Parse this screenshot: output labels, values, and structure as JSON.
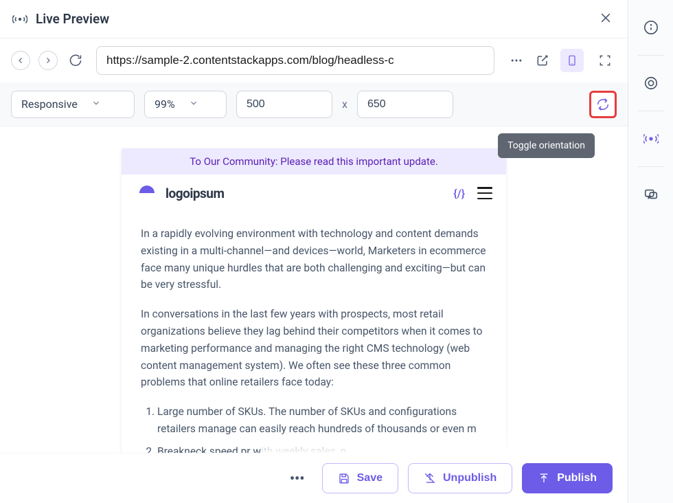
{
  "header": {
    "title": "Live Preview"
  },
  "urlbar": {
    "url": "https://sample-2.contentstackapps.com/blog/headless-c"
  },
  "responsive": {
    "mode": "Responsive",
    "zoom": "99%",
    "width": "500",
    "height": "650",
    "x_label": "x"
  },
  "tooltip": {
    "orientation": "Toggle orientation"
  },
  "preview": {
    "banner": "To Our Community: Please read this important update.",
    "logo_text": "logoipsum",
    "json_icon": "{/}",
    "para1": "In a rapidly evolving environment with technology and content demands existing in a multi-channel—and devices—world, Marketers in ecommerce face many unique hurdles that are both challenging and exciting—but can be very stressful.",
    "para2": "In conversations in the last few years with prospects, most retail organizations believe they lag behind their competitors when it comes to marketing performance and managing the right CMS technology (web content management system). We often see these three common problems that online retailers face today:",
    "list": [
      "Large number of SKUs. The number of SKUs and configurations retailers manage can easily reach hundreds of thousands or even m",
      "Breakneck speed pr                                                              with weekly sales, p"
    ]
  },
  "actions": {
    "more": "•••",
    "save": "Save",
    "unpublish": "Unpublish",
    "publish": "Publish"
  }
}
